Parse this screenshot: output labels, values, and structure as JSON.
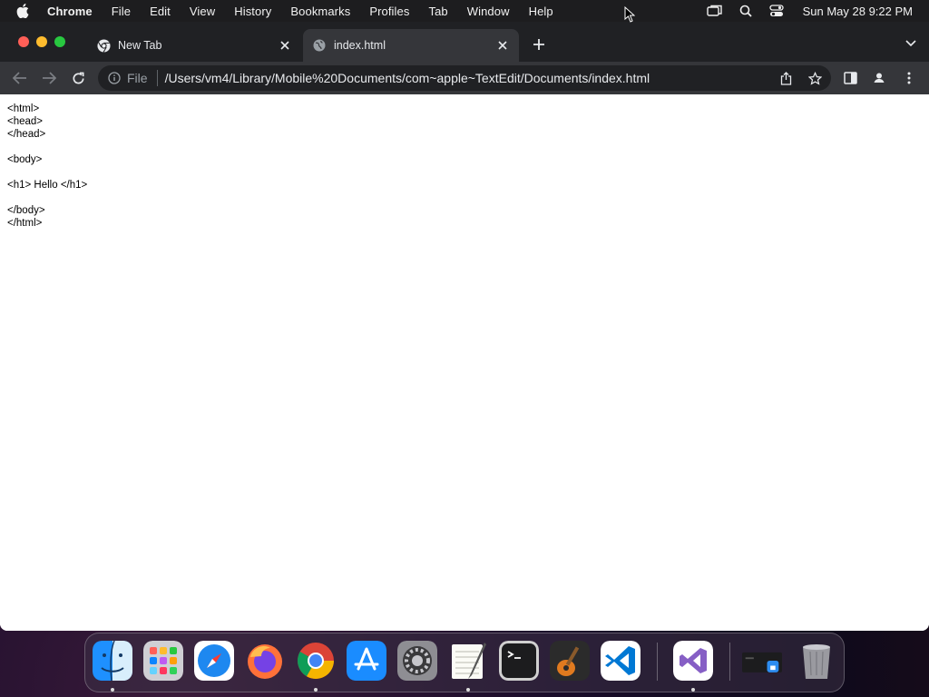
{
  "menubar": {
    "apple_icon": "apple-icon",
    "app_name": "Chrome",
    "items": [
      "File",
      "Edit",
      "View",
      "History",
      "Bookmarks",
      "Profiles",
      "Tab",
      "Window",
      "Help"
    ],
    "clock": "Sun May 28  9:22 PM"
  },
  "tabs": [
    {
      "title": "New Tab",
      "icon": "chrome-icon",
      "active": false
    },
    {
      "title": "index.html",
      "icon": "globe-icon",
      "active": true
    }
  ],
  "toolbar": {
    "scheme": "File",
    "url": "/Users/vm4/Library/Mobile%20Documents/com~apple~TextEdit/Documents/index.html"
  },
  "page": {
    "source_lines": "<html>\n<head>\n</head>\n\n<body>\n\n<h1> Hello </h1>\n\n</body>\n</html>"
  },
  "dock": {
    "apps": [
      "Finder",
      "Launchpad",
      "Safari",
      "Firefox",
      "Chrome",
      "App Store",
      "System Settings",
      "TextEdit",
      "Terminal",
      "GarageBand",
      "Visual Studio Code",
      "Visual Studio",
      "Migration Assistant",
      "Trash"
    ]
  },
  "colors": {
    "tabstrip": "#202124",
    "toolbar": "#35363a",
    "close": "#ff5f57",
    "minimize": "#febc2e",
    "maximize": "#28c840"
  }
}
